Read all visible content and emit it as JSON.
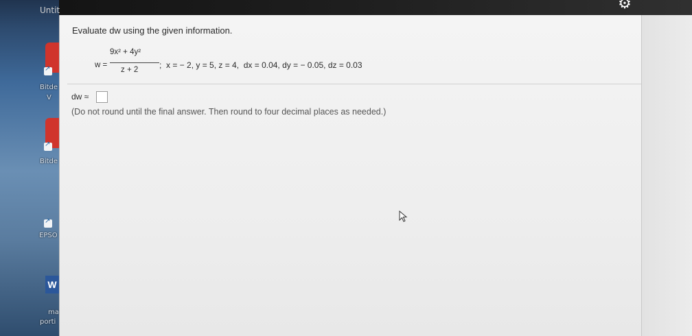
{
  "window": {
    "tab_title": "Untit"
  },
  "desktop": {
    "labels": [
      "Bitde",
      "V",
      "Bitde",
      "EPSO",
      "ma",
      "porti"
    ],
    "word_icon_letter": "W"
  },
  "question": {
    "prompt": "Evaluate dw using the given information.",
    "w_label": "w =",
    "numerator": "9x² + 4y²",
    "denominator": "z + 2",
    "given_values": ";  x = − 2, y = 5, z = 4,  dx = 0.04, dy = − 0.05, dz = 0.03"
  },
  "answer": {
    "label": "dw ≈",
    "value": "",
    "instruction": "(Do not round until the final answer. Then round to four decimal places as needed.)"
  },
  "icons": {
    "settings": "gear-icon",
    "pointer": "mouse-cursor-icon"
  },
  "colors": {
    "panel_bg": "#f2f2f2",
    "text": "#2c2c2c",
    "hint_text": "#555555"
  }
}
